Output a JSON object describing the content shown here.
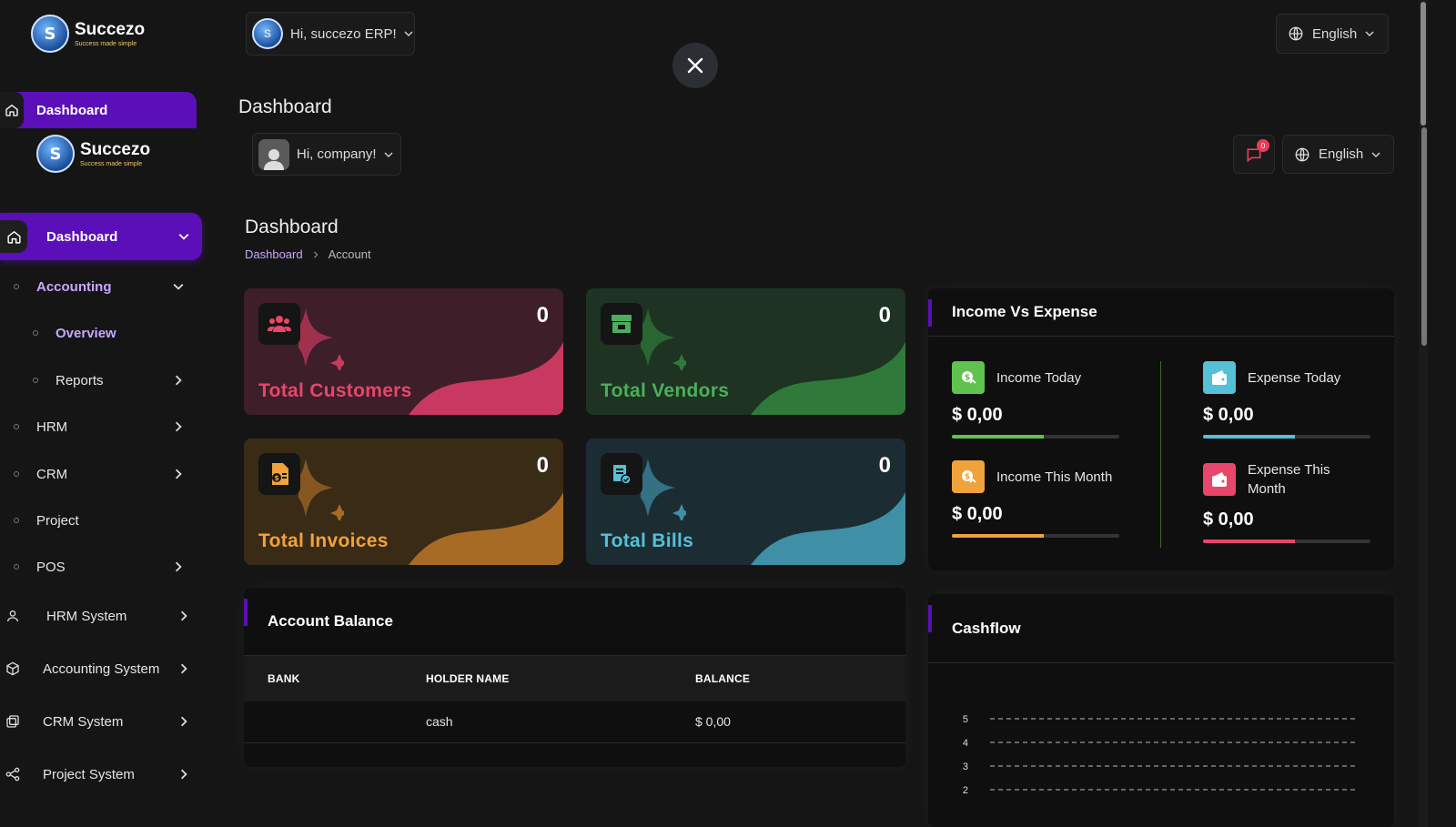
{
  "outer": {
    "logo_name": "Succezo",
    "logo_tagline": "Success made simple",
    "logo_letter": "S",
    "nav_dashboard": "Dashboard",
    "user_greeting": "Hi, succezo ERP!",
    "language": "English",
    "page_title": "Dashboard"
  },
  "sidebar": {
    "logo_name": "Succezo",
    "logo_tagline": "Success made simple",
    "logo_letter": "S",
    "dashboard": "Dashboard",
    "accounting": "Accounting",
    "overview": "Overview",
    "reports": "Reports",
    "hrm": "HRM",
    "crm": "CRM",
    "project": "Project",
    "pos": "POS",
    "hrm_system": "HRM System",
    "accounting_system": "Accounting System",
    "crm_system": "CRM System",
    "project_system": "Project System"
  },
  "header": {
    "user_greeting": "Hi, company!",
    "notification_count": "0",
    "language": "English"
  },
  "page": {
    "title": "Dashboard",
    "breadcrumb": [
      "Dashboard",
      "Account"
    ]
  },
  "stats": [
    {
      "label": "Total Customers",
      "value": "0",
      "color": "#c9395f",
      "icon": "users-icon"
    },
    {
      "label": "Total Vendors",
      "value": "0",
      "color": "#2f7a3a",
      "icon": "vendor-icon"
    },
    {
      "label": "Total Invoices",
      "value": "0",
      "color": "#e68a2e",
      "icon": "invoice-icon"
    },
    {
      "label": "Total Bills",
      "value": "0",
      "color": "#3f8fa7",
      "icon": "bill-icon"
    }
  ],
  "income_expense": {
    "title": "Income Vs Expense",
    "income_today_label": "Income Today",
    "income_today_value": "$ 0,00",
    "income_month_label": "Income This Month",
    "income_month_value": "$ 0,00",
    "expense_today_label": "Expense Today",
    "expense_today_value": "$ 0,00",
    "expense_month_label": "Expense This Month",
    "expense_month_value": "$ 0,00",
    "colors": {
      "income_today": "#5fc34d",
      "income_month": "#f0a23c",
      "expense_today": "#55c0d6",
      "expense_month": "#e8466a"
    }
  },
  "account_balance": {
    "title": "Account Balance",
    "columns": [
      "BANK",
      "HOLDER NAME",
      "BALANCE"
    ],
    "rows": [
      {
        "bank": "",
        "holder": "cash",
        "balance": "$ 0,00"
      }
    ]
  },
  "cashflow": {
    "title": "Cashflow",
    "y_ticks": [
      "5",
      "4",
      "3",
      "2"
    ]
  },
  "accent": "#5a0fb8"
}
